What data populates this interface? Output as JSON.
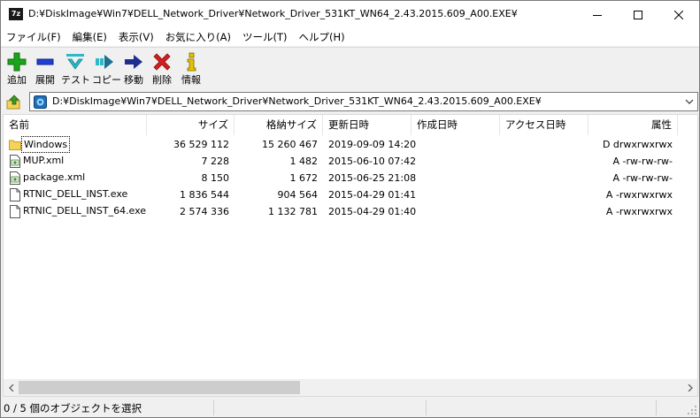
{
  "window": {
    "app_icon_label": "7z",
    "title": "D:¥DiskImage¥Win7¥DELL_Network_Driver¥Network_Driver_531KT_WN64_2.43.2015.609_A00.EXE¥"
  },
  "menu": [
    {
      "label": "ファイル(F)"
    },
    {
      "label": "編集(E)"
    },
    {
      "label": "表示(V)"
    },
    {
      "label": "お気に入り(A)"
    },
    {
      "label": "ツール(T)"
    },
    {
      "label": "ヘルプ(H)"
    }
  ],
  "toolbar": {
    "add": "追加",
    "extract": "展開",
    "test": "テスト",
    "copy": "コピー",
    "move": "移動",
    "delete": "削除",
    "info": "情報"
  },
  "address": {
    "path": "D:¥DiskImage¥Win7¥DELL_Network_Driver¥Network_Driver_531KT_WN64_2.43.2015.609_A00.EXE¥"
  },
  "columns": {
    "name": "名前",
    "size": "サイズ",
    "packed": "格納サイズ",
    "modified": "更新日時",
    "created": "作成日時",
    "accessed": "アクセス日時",
    "attributes": "属性"
  },
  "files": [
    {
      "name": "Windows",
      "type": "folder",
      "size": "36 529 112",
      "packed": "15 260 467",
      "modified": "2019-09-09 14:20",
      "created": "",
      "accessed": "",
      "attributes": "D drwxrwxrwx"
    },
    {
      "name": "MUP.xml",
      "type": "xml",
      "size": "7 228",
      "packed": "1 482",
      "modified": "2015-06-10 07:42",
      "created": "",
      "accessed": "",
      "attributes": "A -rw-rw-rw-"
    },
    {
      "name": "package.xml",
      "type": "xml",
      "size": "8 150",
      "packed": "1 672",
      "modified": "2015-06-25 21:08",
      "created": "",
      "accessed": "",
      "attributes": "A -rw-rw-rw-"
    },
    {
      "name": "RTNIC_DELL_INST.exe",
      "type": "file",
      "size": "1 836 544",
      "packed": "904 564",
      "modified": "2015-04-29 01:41",
      "created": "",
      "accessed": "",
      "attributes": "A -rwxrwxrwx"
    },
    {
      "name": "RTNIC_DELL_INST_64.exe",
      "type": "file",
      "size": "2 574 336",
      "packed": "1 132 781",
      "modified": "2015-04-29 01:40",
      "created": "",
      "accessed": "",
      "attributes": "A -rwxrwxrwx"
    }
  ],
  "status": {
    "selection": "0 / 5 個のオブジェクトを選択"
  },
  "colors": {
    "folder": "#f5d35a",
    "add_green": "#1aa51a",
    "extract_blue": "#1f3fd1",
    "test_teal": "#2bb8c8",
    "move_navy": "#1c2f8f",
    "delete_red": "#d21e1e",
    "info_yellow": "#e6c200"
  }
}
